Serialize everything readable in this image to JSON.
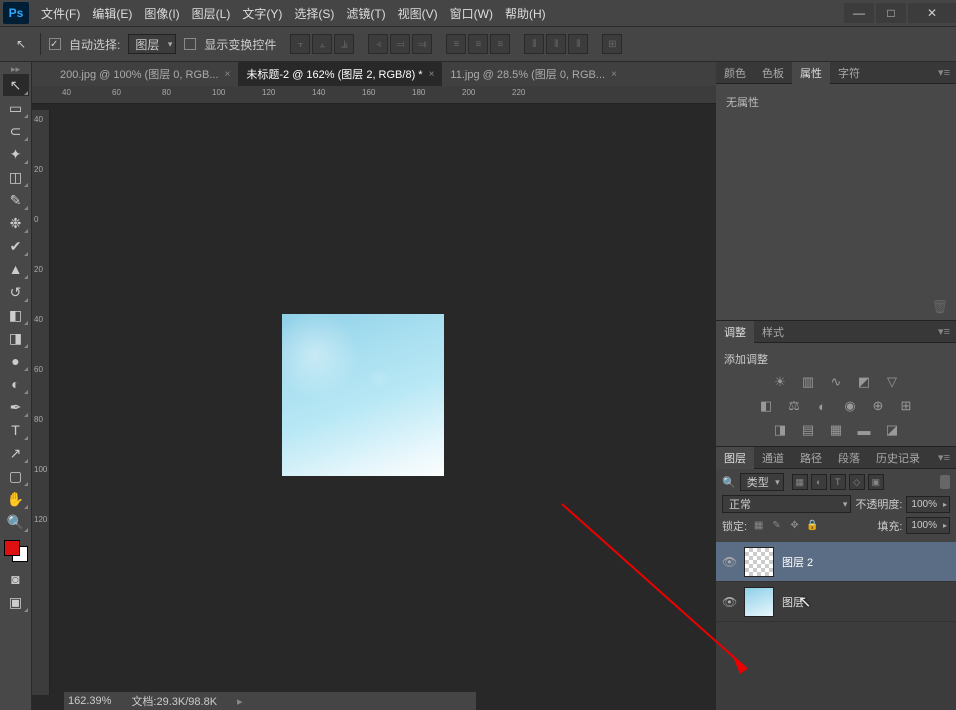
{
  "app": {
    "logo": "Ps"
  },
  "menu": [
    "文件(F)",
    "编辑(E)",
    "图像(I)",
    "图层(L)",
    "文字(Y)",
    "选择(S)",
    "滤镜(T)",
    "视图(V)",
    "窗口(W)",
    "帮助(H)"
  ],
  "optionbar": {
    "auto_select": "自动选择:",
    "target": "图层",
    "show_transform": "显示变换控件"
  },
  "tabs": [
    {
      "label": "200.jpg @ 100% (图层 0, RGB...",
      "active": false
    },
    {
      "label": "未标题-2 @ 162% (图层 2, RGB/8) *",
      "active": true
    },
    {
      "label": "11.jpg @ 28.5% (图层 0, RGB...",
      "active": false
    }
  ],
  "ruler_h": [
    "40",
    "60",
    "80",
    "100",
    "120",
    "140",
    "160",
    "180",
    "200",
    "220"
  ],
  "ruler_v": [
    "40",
    "20",
    "0",
    "20",
    "40",
    "60",
    "80",
    "100",
    "120"
  ],
  "status": {
    "zoom": "162.39%",
    "doc": "文档:29.3K/98.8K"
  },
  "panels": {
    "props": {
      "tabs": [
        "颜色",
        "色板",
        "属性",
        "字符"
      ],
      "active": 2,
      "text": "无属性"
    },
    "adjust": {
      "tabs": [
        "调整",
        "样式"
      ],
      "active": 0,
      "title": "添加调整"
    },
    "layers": {
      "tabs": [
        "图层",
        "通道",
        "路径",
        "段落",
        "历史记录"
      ],
      "active": 0,
      "kind_label": "类型",
      "blend": "正常",
      "opacity_label": "不透明度:",
      "opacity": "100%",
      "lock_label": "锁定:",
      "fill_label": "填充:",
      "fill": "100%",
      "items": [
        {
          "name": "图层 2",
          "selected": true,
          "thumb": "trans"
        },
        {
          "name": "图层",
          "selected": false,
          "thumb": "sky"
        }
      ]
    }
  },
  "cursor_label": "图"
}
